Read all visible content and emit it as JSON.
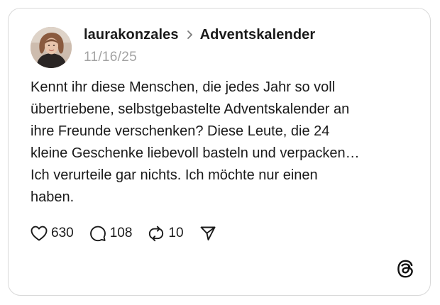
{
  "post": {
    "username": "laurakonzales",
    "topic": "Adventskalender",
    "date": "11/16/25",
    "text": "Kennt ihr diese Menschen, die jedes Jahr so voll\nübertriebene, selbstgebastelte Adventskalender an\nihre Freunde verschenken? Diese Leute, die 24\nkleine Geschenke liebevoll basteln und verpacken…\nIch verurteile gar nichts. Ich möchte nur einen\nhaben."
  },
  "actions": {
    "likes": "630",
    "replies": "108",
    "reposts": "10"
  },
  "icons": {
    "avatar": "avatar-photo",
    "separator": "chevron-right-icon",
    "like": "heart-icon",
    "reply": "speech-bubble-icon",
    "repost": "repost-icon",
    "share": "send-icon",
    "brand": "threads-logo-icon"
  },
  "colors": {
    "text": "#1a1a1a",
    "muted": "#a3a3a3",
    "border": "#d9d9d9"
  }
}
